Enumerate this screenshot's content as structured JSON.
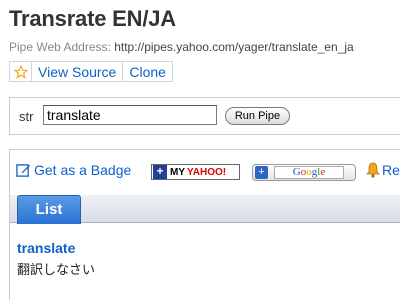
{
  "page": {
    "title": "Transrate EN/JA",
    "address_label": "Pipe Web Address:",
    "address_url": "http://pipes.yahoo.com/yager/translate_en_ja"
  },
  "actions": {
    "star_icon": "star-icon",
    "view_source": "View Source",
    "clone": "Clone"
  },
  "run_form": {
    "param_label": "str",
    "param_value": "translate",
    "run_button": "Run Pipe"
  },
  "output": {
    "badge_link": "Get as a Badge",
    "my_yahoo": {
      "my": "MY",
      "yahoo": "YAHOO!"
    },
    "google_letters": [
      "G",
      "o",
      "o",
      "g",
      "l",
      "e"
    ],
    "rss_label": "Re",
    "tabs": [
      {
        "label": "List",
        "active": true
      }
    ],
    "results": [
      {
        "title": "translate",
        "description": "翻訳しなさい"
      }
    ]
  },
  "colors": {
    "link": "#0b62c9",
    "tab_active": "#2a72d4",
    "star": "#f5a623"
  }
}
